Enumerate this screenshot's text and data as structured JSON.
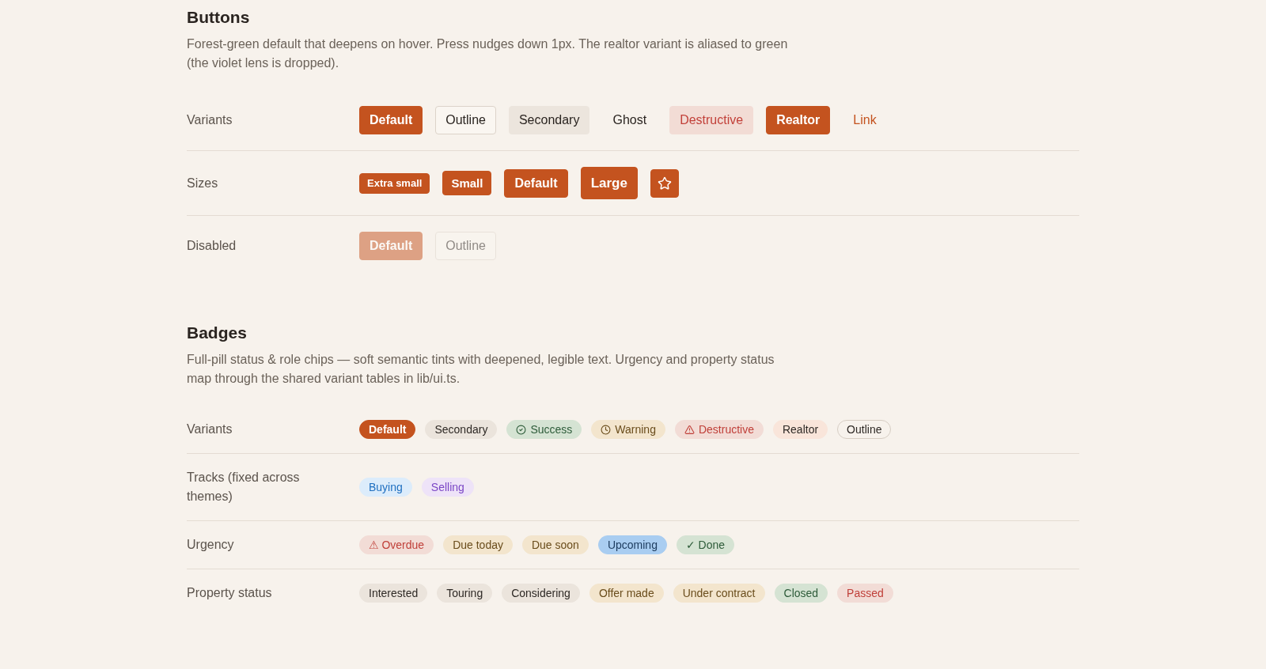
{
  "sections": [
    {
      "kind": "buttons",
      "title": "Buttons",
      "description": "Forest-green default that deepens on hover. Press nudges down 1px. The realtor variant is aliased to green (the violet lens is dropped).",
      "rows": [
        {
          "label": "Variants",
          "items": [
            {
              "label": "Default",
              "kind": "default"
            },
            {
              "label": "Outline",
              "kind": "outline"
            },
            {
              "label": "Secondary",
              "kind": "secondary"
            },
            {
              "label": "Ghost",
              "kind": "ghost"
            },
            {
              "label": "Destructive",
              "kind": "destructive"
            },
            {
              "label": "Realtor",
              "kind": "realtor"
            },
            {
              "label": "Link",
              "kind": "link"
            }
          ]
        },
        {
          "label": "Sizes",
          "items": [
            {
              "label": "Extra small",
              "kind": "xs"
            },
            {
              "label": "Small",
              "kind": "sm"
            },
            {
              "label": "Default",
              "kind": "default"
            },
            {
              "label": "Large",
              "kind": "lg"
            },
            {
              "kind": "icon"
            }
          ]
        },
        {
          "label": "Disabled",
          "items": [
            {
              "label": "Default",
              "kind": "default",
              "disabled": true
            },
            {
              "label": "Outline",
              "kind": "outline",
              "disabled": true
            }
          ]
        }
      ]
    },
    {
      "kind": "badges",
      "title": "Badges",
      "description": "Full-pill status & role chips — soft semantic tints with deepened, legible text. Urgency and property status map through the shared variant tables in lib/ui.ts.",
      "rows": [
        {
          "label": "Variants",
          "items": [
            {
              "label": "Default",
              "kind": "default"
            },
            {
              "label": "Secondary",
              "kind": "secondary"
            },
            {
              "label": "Success",
              "kind": "success",
              "icon": true
            },
            {
              "label": "Warning",
              "kind": "warning",
              "icon": true
            },
            {
              "label": "Destructive",
              "kind": "destructive",
              "icon": true
            },
            {
              "label": "Realtor",
              "kind": "realtor"
            },
            {
              "label": "Outline",
              "kind": "outline"
            }
          ]
        },
        {
          "label": "Tracks (fixed across themes)",
          "items": [
            {
              "label": "Buying",
              "kind": "buying"
            },
            {
              "label": "Selling",
              "kind": "selling"
            }
          ]
        },
        {
          "label": "Urgency",
          "items": [
            {
              "label": "⚠ Overdue",
              "kind": "destructive"
            },
            {
              "label": "Due today",
              "kind": "warning"
            },
            {
              "label": "Due soon",
              "kind": "warning"
            },
            {
              "label": "Upcoming",
              "kind": "info"
            },
            {
              "label": "✓ Done",
              "kind": "success"
            }
          ]
        },
        {
          "label": "Property status",
          "items": [
            {
              "label": "Interested",
              "kind": "secondary"
            },
            {
              "label": "Touring",
              "kind": "secondary"
            },
            {
              "label": "Considering",
              "kind": "secondary"
            },
            {
              "label": "Offer made",
              "kind": "warning"
            },
            {
              "label": "Under contract",
              "kind": "warning"
            },
            {
              "label": "Closed",
              "kind": "success"
            },
            {
              "label": "Passed",
              "kind": "destructive"
            }
          ]
        }
      ]
    }
  ]
}
